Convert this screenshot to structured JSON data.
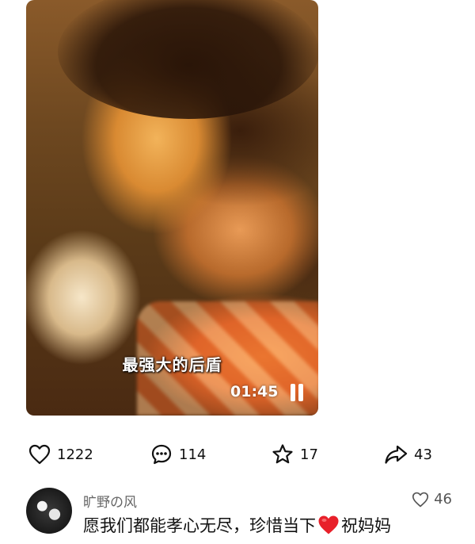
{
  "video": {
    "subtitle": "最强大的后盾",
    "timecode": "01:45",
    "state_icon": "pause-icon"
  },
  "actions": {
    "like": {
      "icon": "heart-outline-icon",
      "count": "1222"
    },
    "comment": {
      "icon": "comment-bubble-icon",
      "count": "114"
    },
    "favorite": {
      "icon": "star-outline-icon",
      "count": "17"
    },
    "share": {
      "icon": "share-arrow-icon",
      "count": "43"
    }
  },
  "comment": {
    "username": "旷野の风",
    "text_before": "愿我们都能孝心无尽，珍惜当下",
    "emoji": "red-heart",
    "text_after": "祝妈妈",
    "like_icon": "heart-outline-icon",
    "like_count": "46"
  },
  "colors": {
    "emoji_heart": "#e8202a",
    "text": "#111111",
    "muted": "#666666"
  }
}
